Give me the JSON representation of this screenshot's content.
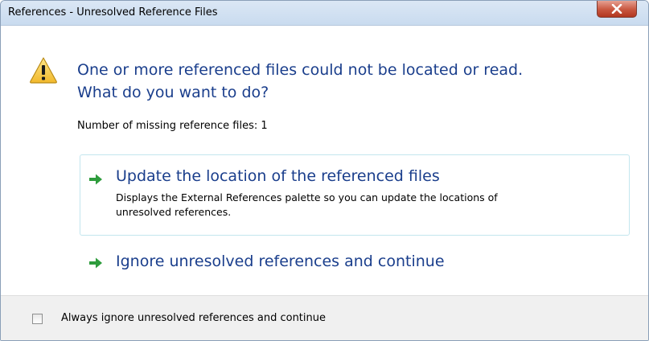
{
  "window": {
    "title": "References - Unresolved Reference Files"
  },
  "icons": {
    "warning": "warning-triangle",
    "close": "close-x",
    "option_arrow": "green-right-arrow"
  },
  "main": {
    "heading_line1": "One or more referenced files could not be located or read.",
    "heading_line2": "What do you want to do?",
    "missing_count_text": "Number of missing reference files: 1"
  },
  "options": [
    {
      "title": "Update the location of the referenced files",
      "description_line1": "Displays the External References palette so you can update the locations of",
      "description_line2": "unresolved references."
    },
    {
      "title": "Ignore unresolved references and continue"
    }
  ],
  "footer": {
    "checkbox_label": "Always ignore unresolved references and continue",
    "checkbox_checked": false
  },
  "colors": {
    "heading": "#1a3e8c",
    "arrow": "#2e9c3c",
    "close_button": "#c8563f",
    "warning_fill": "#f5c83a"
  }
}
